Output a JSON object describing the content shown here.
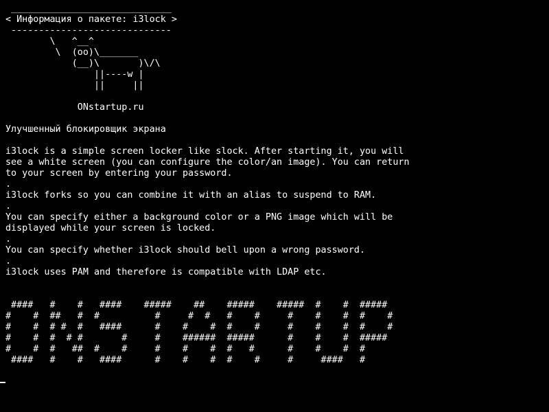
{
  "terminal": {
    "colors": {
      "background": "#000000",
      "foreground": "#ffffff"
    },
    "header_lines": [
      " _____________________________",
      "< Информация о пакете: i3lock >",
      " -----------------------------",
      "        \\   ^__^",
      "         \\  (oo)\\_______",
      "            (__)\\       )\\/\\",
      "                ||----w |",
      "                ||     ||",
      "",
      "             ONstartup.ru",
      ""
    ],
    "summary": "Улучшенный блокировщик экрана",
    "description_lines": [
      "",
      "i3lock is a simple screen locker like slock. After starting it, you will",
      "see a white screen (you can configure the color/an image). You can return",
      "to your screen by entering your password.",
      ".",
      "i3lock forks so you can combine it with an alias to suspend to RAM.",
      ".",
      "You can specify either a background color or a PNG image which will be",
      "displayed while your screen is locked.",
      ".",
      "You can specify whether i3lock should bell upon a wrong password.",
      ".",
      "i3lock uses PAM and therefore is compatible with LDAP etc.",
      "",
      ""
    ],
    "banner_lines": [
      " ####   #    #   ####    #####    ##    #####    #####  #    #  #####",
      "#    #  ##   #  #          #     #  #   #    #     #    #    #  #    #",
      "#    #  # #  #   ####      #    #    #  #    #     #    #    #  #    #",
      "#    #  #  # #       #     #    ######  #####      #    #    #  #####",
      "#    #  #   ##  #    #     #    #    #  #   #      #    #    #  #",
      " ####   #    #   ####      #    #    #  #    #     #     ####   #"
    ]
  }
}
